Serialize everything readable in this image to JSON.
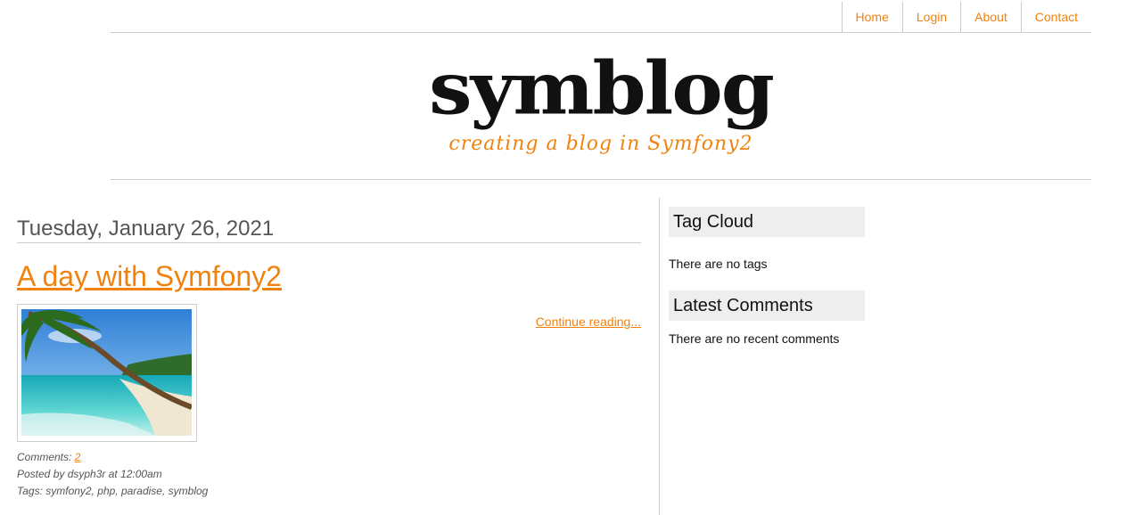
{
  "nav": {
    "items": [
      "Home",
      "Login",
      "About",
      "Contact"
    ]
  },
  "header": {
    "logo_text": "symblog",
    "tagline": "creating a blog in Symfony2"
  },
  "post": {
    "date": "Tuesday, January 26, 2021",
    "title": "A day with Symfony2",
    "continue_label": "Continue reading...",
    "comments_label": "Comments:",
    "comments_count": "2",
    "posted_by": "Posted by dsyph3r at 12:00am",
    "tags": "Tags: symfony2, php, paradise, symblog"
  },
  "sidebar": {
    "tag_cloud": {
      "title": "Tag Cloud",
      "text": "There are no tags"
    },
    "latest_comments": {
      "title": "Latest Comments",
      "text": "There are no recent comments"
    }
  },
  "colors": {
    "accent": "#f0820f",
    "border": "#cccccc",
    "widget_bg": "#eeeeee",
    "muted_text": "#555555"
  }
}
